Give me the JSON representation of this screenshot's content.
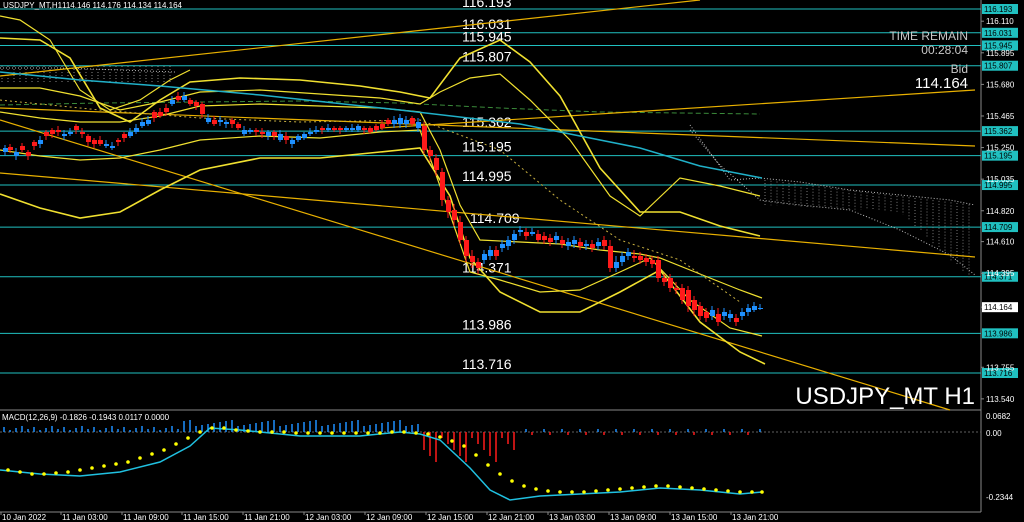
{
  "header": {
    "symbol": "USDJPY_MT,H1",
    "ohlc": "114.146 114.176 114.134 114.164"
  },
  "symbol_big": "USDJPY_MT H1",
  "timer": {
    "title": "TIME REMAIN",
    "value": "00:28:04"
  },
  "bid": {
    "label": "Bid",
    "value": "114.164"
  },
  "macd": {
    "title": "MACD(12,26,9) -0.1826 -0.1943 0.0117 0.0000",
    "scale": [
      "0.0682",
      "0.00",
      "-0.2344"
    ]
  },
  "price_axis": [
    "116.193",
    "116.110",
    "116.031",
    "115.945",
    "115.895",
    "115.807",
    "115.680",
    "115.465",
    "115.362",
    "115.250",
    "115.195",
    "115.035",
    "114.995",
    "114.820",
    "114.709",
    "114.610",
    "114.371",
    "114.395",
    "114.164",
    "113.986",
    "113.755",
    "113.716",
    "113.540"
  ],
  "levels": [
    {
      "price": "116.193"
    },
    {
      "price": "116.031"
    },
    {
      "price": "115.945"
    },
    {
      "price": "115.807"
    },
    {
      "price": "115.362"
    },
    {
      "price": "115.195"
    },
    {
      "price": "114.995"
    },
    {
      "price": "114.709"
    },
    {
      "price": "114.371"
    },
    {
      "price": "113.986"
    },
    {
      "price": "113.716"
    }
  ],
  "time_axis": [
    "10 Jan 2022",
    "11 Jan 03:00",
    "11 Jan 09:00",
    "11 Jan 15:00",
    "11 Jan 21:00",
    "12 Jan 03:00",
    "12 Jan 09:00",
    "12 Jan 15:00",
    "12 Jan 21:00",
    "13 Jan 03:00",
    "13 Jan 09:00",
    "13 Jan 15:00",
    "13 Jan 21:00"
  ],
  "colors": {
    "background": "#000000",
    "level_line": "#20c0c0",
    "bull": "#1e90ff",
    "bear": "#ff1a1a",
    "band": "#f0e030",
    "trend": "#e8b000",
    "macd_line": "#20c0e0",
    "signal": "#ffff00"
  }
}
